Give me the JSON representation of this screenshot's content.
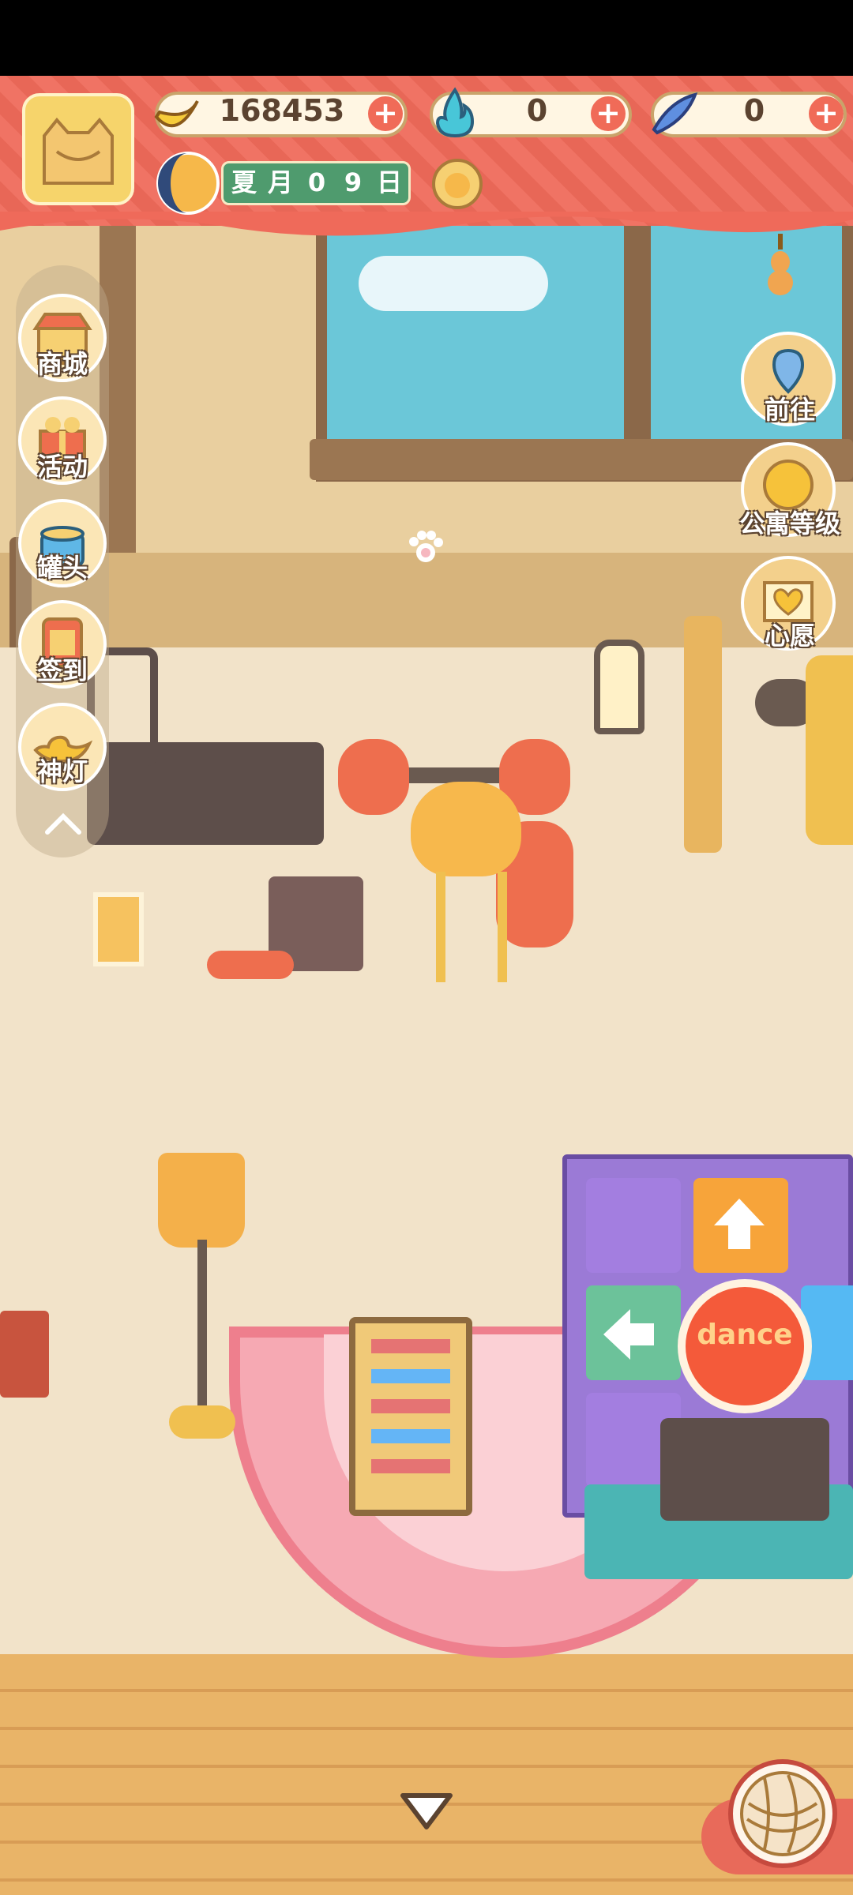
{
  "header": {
    "banana_count": "168453",
    "flame_count": "0",
    "fish_count": "0",
    "season": "夏",
    "month_label": "月",
    "day_digits": [
      "0",
      "9"
    ],
    "day_label": "日"
  },
  "left_menu": [
    {
      "label": "商城",
      "icon": "shop-icon"
    },
    {
      "label": "活动",
      "icon": "gift-icon"
    },
    {
      "label": "罐头",
      "icon": "can-icon"
    },
    {
      "label": "签到",
      "icon": "calendar-icon"
    },
    {
      "label": "神灯",
      "icon": "magic-lamp-icon"
    }
  ],
  "right_menu": [
    {
      "label": "前往",
      "icon": "map-pin-icon"
    },
    {
      "label": "公寓等级",
      "icon": "sun-badge-icon"
    },
    {
      "label": "心愿",
      "icon": "heart-book-icon"
    }
  ],
  "scene": {
    "dance_pad_label": "dance"
  },
  "colors": {
    "header_red": "#ef6a5a",
    "pill_border": "#c9a36a",
    "date_green": "#4f9b6e",
    "floor": "#f2e3c9"
  }
}
